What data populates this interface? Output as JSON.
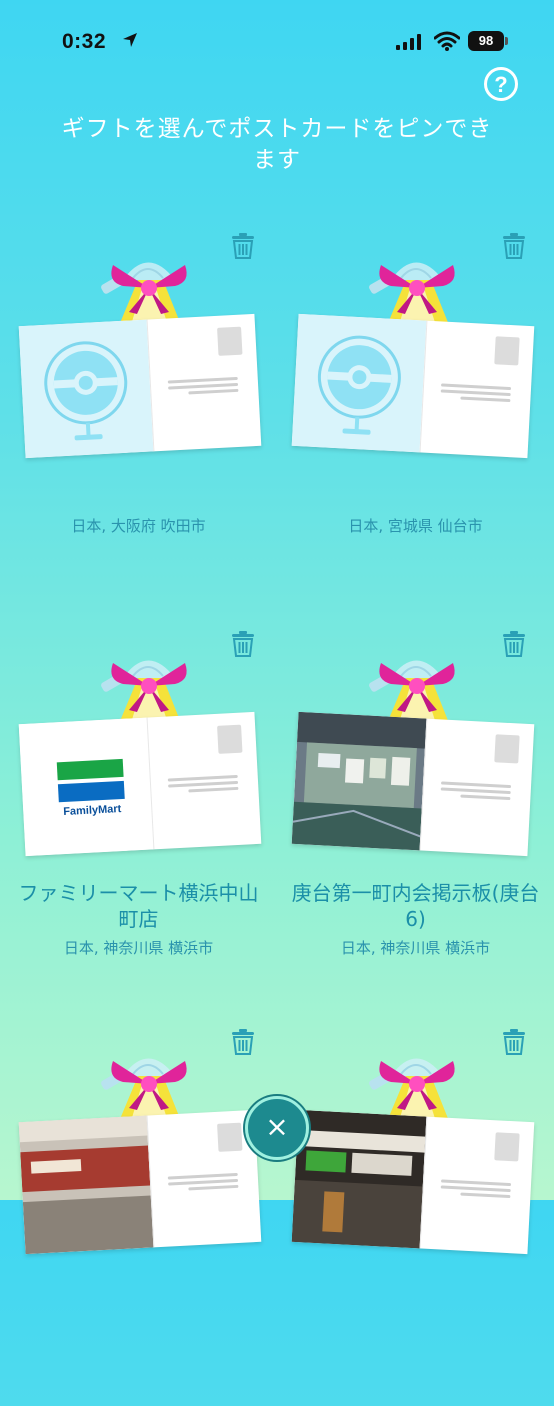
{
  "status_bar": {
    "time": "0:32",
    "battery": "98"
  },
  "header": {
    "help_label": "?",
    "instruction": "ギフトを選んでポストカードをピンできます"
  },
  "cards": [
    {
      "title": "",
      "subtitle": "日本, 大阪府 吹田市",
      "image": "pokestop-icon"
    },
    {
      "title": "",
      "subtitle": "日本, 宮城県 仙台市",
      "image": "pokestop-icon"
    },
    {
      "title": "ファミリーマート横浜中山町店",
      "subtitle": "日本, 神奈川県 横浜市",
      "image": "familymart-logo",
      "logo_text": "FamilyMart"
    },
    {
      "title": "庚台第一町内会掲示板(庚台6)",
      "subtitle": "日本, 神奈川県 横浜市",
      "image": "bulletin-board-photo"
    },
    {
      "title": "",
      "subtitle": "",
      "image": "storefront-photo"
    },
    {
      "title": "",
      "subtitle": "",
      "image": "station-photo"
    }
  ],
  "close_label": "×",
  "colors": {
    "text_teal": "#1b8fa8",
    "bow_magenta": "#e0249a",
    "close_bg": "#1d8a8f"
  }
}
